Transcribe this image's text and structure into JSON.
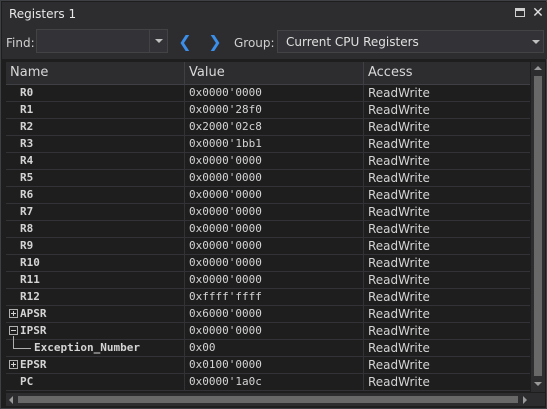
{
  "window": {
    "title": "Registers 1",
    "restore_icon": "restore-icon",
    "close_glyph": "✕"
  },
  "toolbar": {
    "find_label": "Find:",
    "find_value": "",
    "prev_glyph": "❮",
    "next_glyph": "❯",
    "group_label": "Group:",
    "group_value": "Current CPU Registers"
  },
  "table": {
    "columns": [
      "Name",
      "Value",
      "Access"
    ],
    "rows": [
      {
        "name": "R0",
        "value": "0x0000'0000",
        "access": "ReadWrite",
        "expander": "none",
        "depth": 0
      },
      {
        "name": "R1",
        "value": "0x0000'28f0",
        "access": "ReadWrite",
        "expander": "none",
        "depth": 0
      },
      {
        "name": "R2",
        "value": "0x2000'02c8",
        "access": "ReadWrite",
        "expander": "none",
        "depth": 0
      },
      {
        "name": "R3",
        "value": "0x0000'1bb1",
        "access": "ReadWrite",
        "expander": "none",
        "depth": 0
      },
      {
        "name": "R4",
        "value": "0x0000'0000",
        "access": "ReadWrite",
        "expander": "none",
        "depth": 0
      },
      {
        "name": "R5",
        "value": "0x0000'0000",
        "access": "ReadWrite",
        "expander": "none",
        "depth": 0
      },
      {
        "name": "R6",
        "value": "0x0000'0000",
        "access": "ReadWrite",
        "expander": "none",
        "depth": 0
      },
      {
        "name": "R7",
        "value": "0x0000'0000",
        "access": "ReadWrite",
        "expander": "none",
        "depth": 0
      },
      {
        "name": "R8",
        "value": "0x0000'0000",
        "access": "ReadWrite",
        "expander": "none",
        "depth": 0
      },
      {
        "name": "R9",
        "value": "0x0000'0000",
        "access": "ReadWrite",
        "expander": "none",
        "depth": 0
      },
      {
        "name": "R10",
        "value": "0x0000'0000",
        "access": "ReadWrite",
        "expander": "none",
        "depth": 0
      },
      {
        "name": "R11",
        "value": "0x0000'0000",
        "access": "ReadWrite",
        "expander": "none",
        "depth": 0
      },
      {
        "name": "R12",
        "value": "0xffff'ffff",
        "access": "ReadWrite",
        "expander": "none",
        "depth": 0
      },
      {
        "name": "APSR",
        "value": "0x6000'0000",
        "access": "ReadWrite",
        "expander": "collapsed",
        "depth": 0
      },
      {
        "name": "IPSR",
        "value": "0x0000'0000",
        "access": "ReadWrite",
        "expander": "expanded",
        "depth": 0
      },
      {
        "name": "Exception_Number",
        "value": "0x00",
        "access": "ReadWrite",
        "expander": "none",
        "depth": 1
      },
      {
        "name": "EPSR",
        "value": "0x0100'0000",
        "access": "ReadWrite",
        "expander": "collapsed",
        "depth": 0
      },
      {
        "name": "PC",
        "value": "0x0000'1a0c",
        "access": "ReadWrite",
        "expander": "none",
        "depth": 0
      }
    ]
  }
}
